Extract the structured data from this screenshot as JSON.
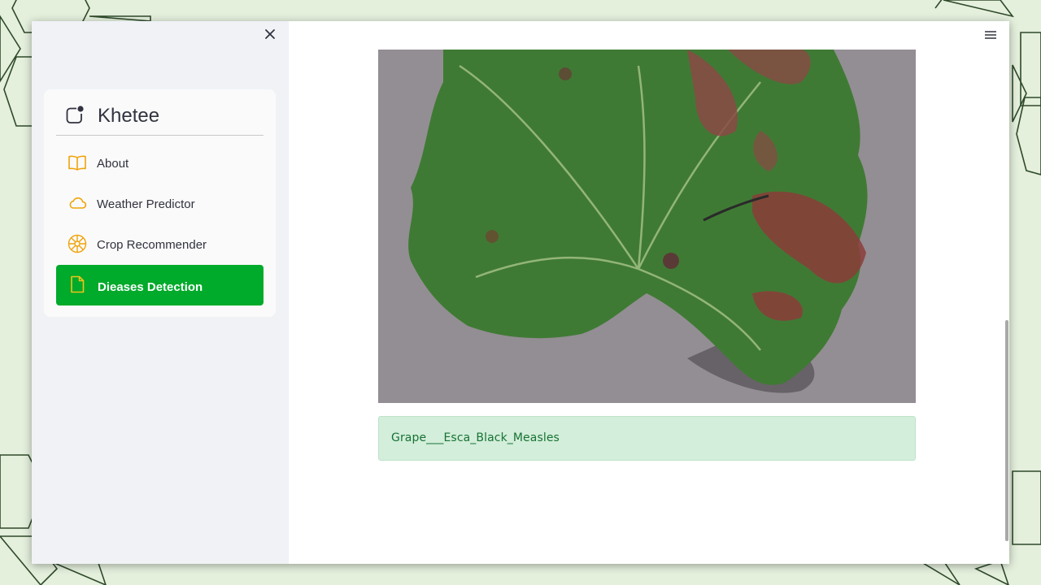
{
  "app": {
    "title": "Khetee"
  },
  "sidebar": {
    "close_icon": "close-icon",
    "brand_icon": "app-indicator-icon",
    "items": [
      {
        "label": "About",
        "icon": "book-icon",
        "active": false
      },
      {
        "label": "Weather Predictor",
        "icon": "cloud-icon",
        "active": false
      },
      {
        "label": "Crop Recommender",
        "icon": "flower-icon",
        "active": false
      },
      {
        "label": "Dieases Detection",
        "icon": "file-icon",
        "active": true
      }
    ]
  },
  "main": {
    "menu_icon": "hamburger-menu-icon",
    "result": "Grape___Esca_Black_Measles"
  },
  "colors": {
    "accent": "#00aa2a",
    "icon": "#f0a30a",
    "success_bg": "#d3eedb",
    "success_text": "#177233"
  }
}
